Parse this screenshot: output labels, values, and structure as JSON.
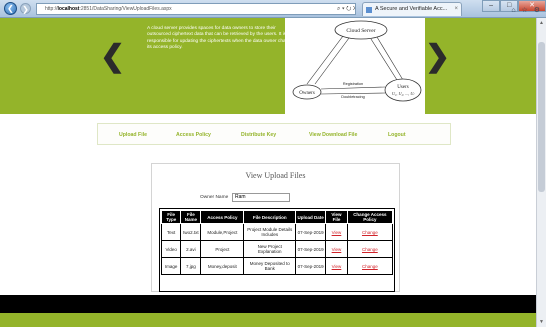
{
  "browser": {
    "back_glyph": "❮",
    "forward_glyph": "❯",
    "url_prefix": "http://",
    "url_host": "localhost",
    "url_path": ":2851/DataSharing/ViewUploadFiles.aspx",
    "address_icons": "⌕ ▾ ⭮ ✕",
    "tab_title": "A Secure and Verifiable Acc...",
    "tab_close": "×",
    "minimize": "–",
    "maximize": "□",
    "close": "✕",
    "toolbar_icons": "⌂ ☆ ⚙"
  },
  "banner": {
    "text": "A cloud server provides spaces for data owners to store their outsourced ciphertext data that can be retrieved by the users. It is also responsible for updating the ciphertexts when the data owner changes its access policy.",
    "prev_glyph": "❮",
    "next_glyph": "❯",
    "diagram": {
      "cloud_label": "Cloud Server",
      "owners_label": "Owners",
      "users_label": "Users",
      "users_set": "U₁, U₂, ..., Uₗ",
      "registration_label": "Registration",
      "doubletracing_label": "Doubletracing"
    }
  },
  "nav": {
    "items": [
      "Upload File",
      "Access Policy",
      "Distribute Key",
      "View Download File",
      "Logout"
    ]
  },
  "panel": {
    "title": "View Upload Files",
    "owner_label": "Owner Name",
    "owner_value": "Ram"
  },
  "table": {
    "headers": [
      "File Type",
      "File Name",
      "Access Policy",
      "File Description",
      "Upload Date",
      "View File",
      "Change Access Policy"
    ],
    "rows": [
      [
        "Text",
        "two2.txt",
        "Module,Project",
        "Project Module Details Includes",
        "07-Sep-2019",
        "View",
        "Change"
      ],
      [
        "Video",
        "2.avi",
        "Project",
        "New Project Explanation",
        "07-Sep-2019",
        "View",
        "Change"
      ],
      [
        "Image",
        "7.jpg",
        "Money,deposit",
        "Money Deposited to Bank",
        "07-Sep-2019",
        "View",
        "Change"
      ]
    ]
  },
  "colors": {
    "brand_green": "#94b42a",
    "link_red": "#d1232a",
    "table_header": "#000000"
  }
}
